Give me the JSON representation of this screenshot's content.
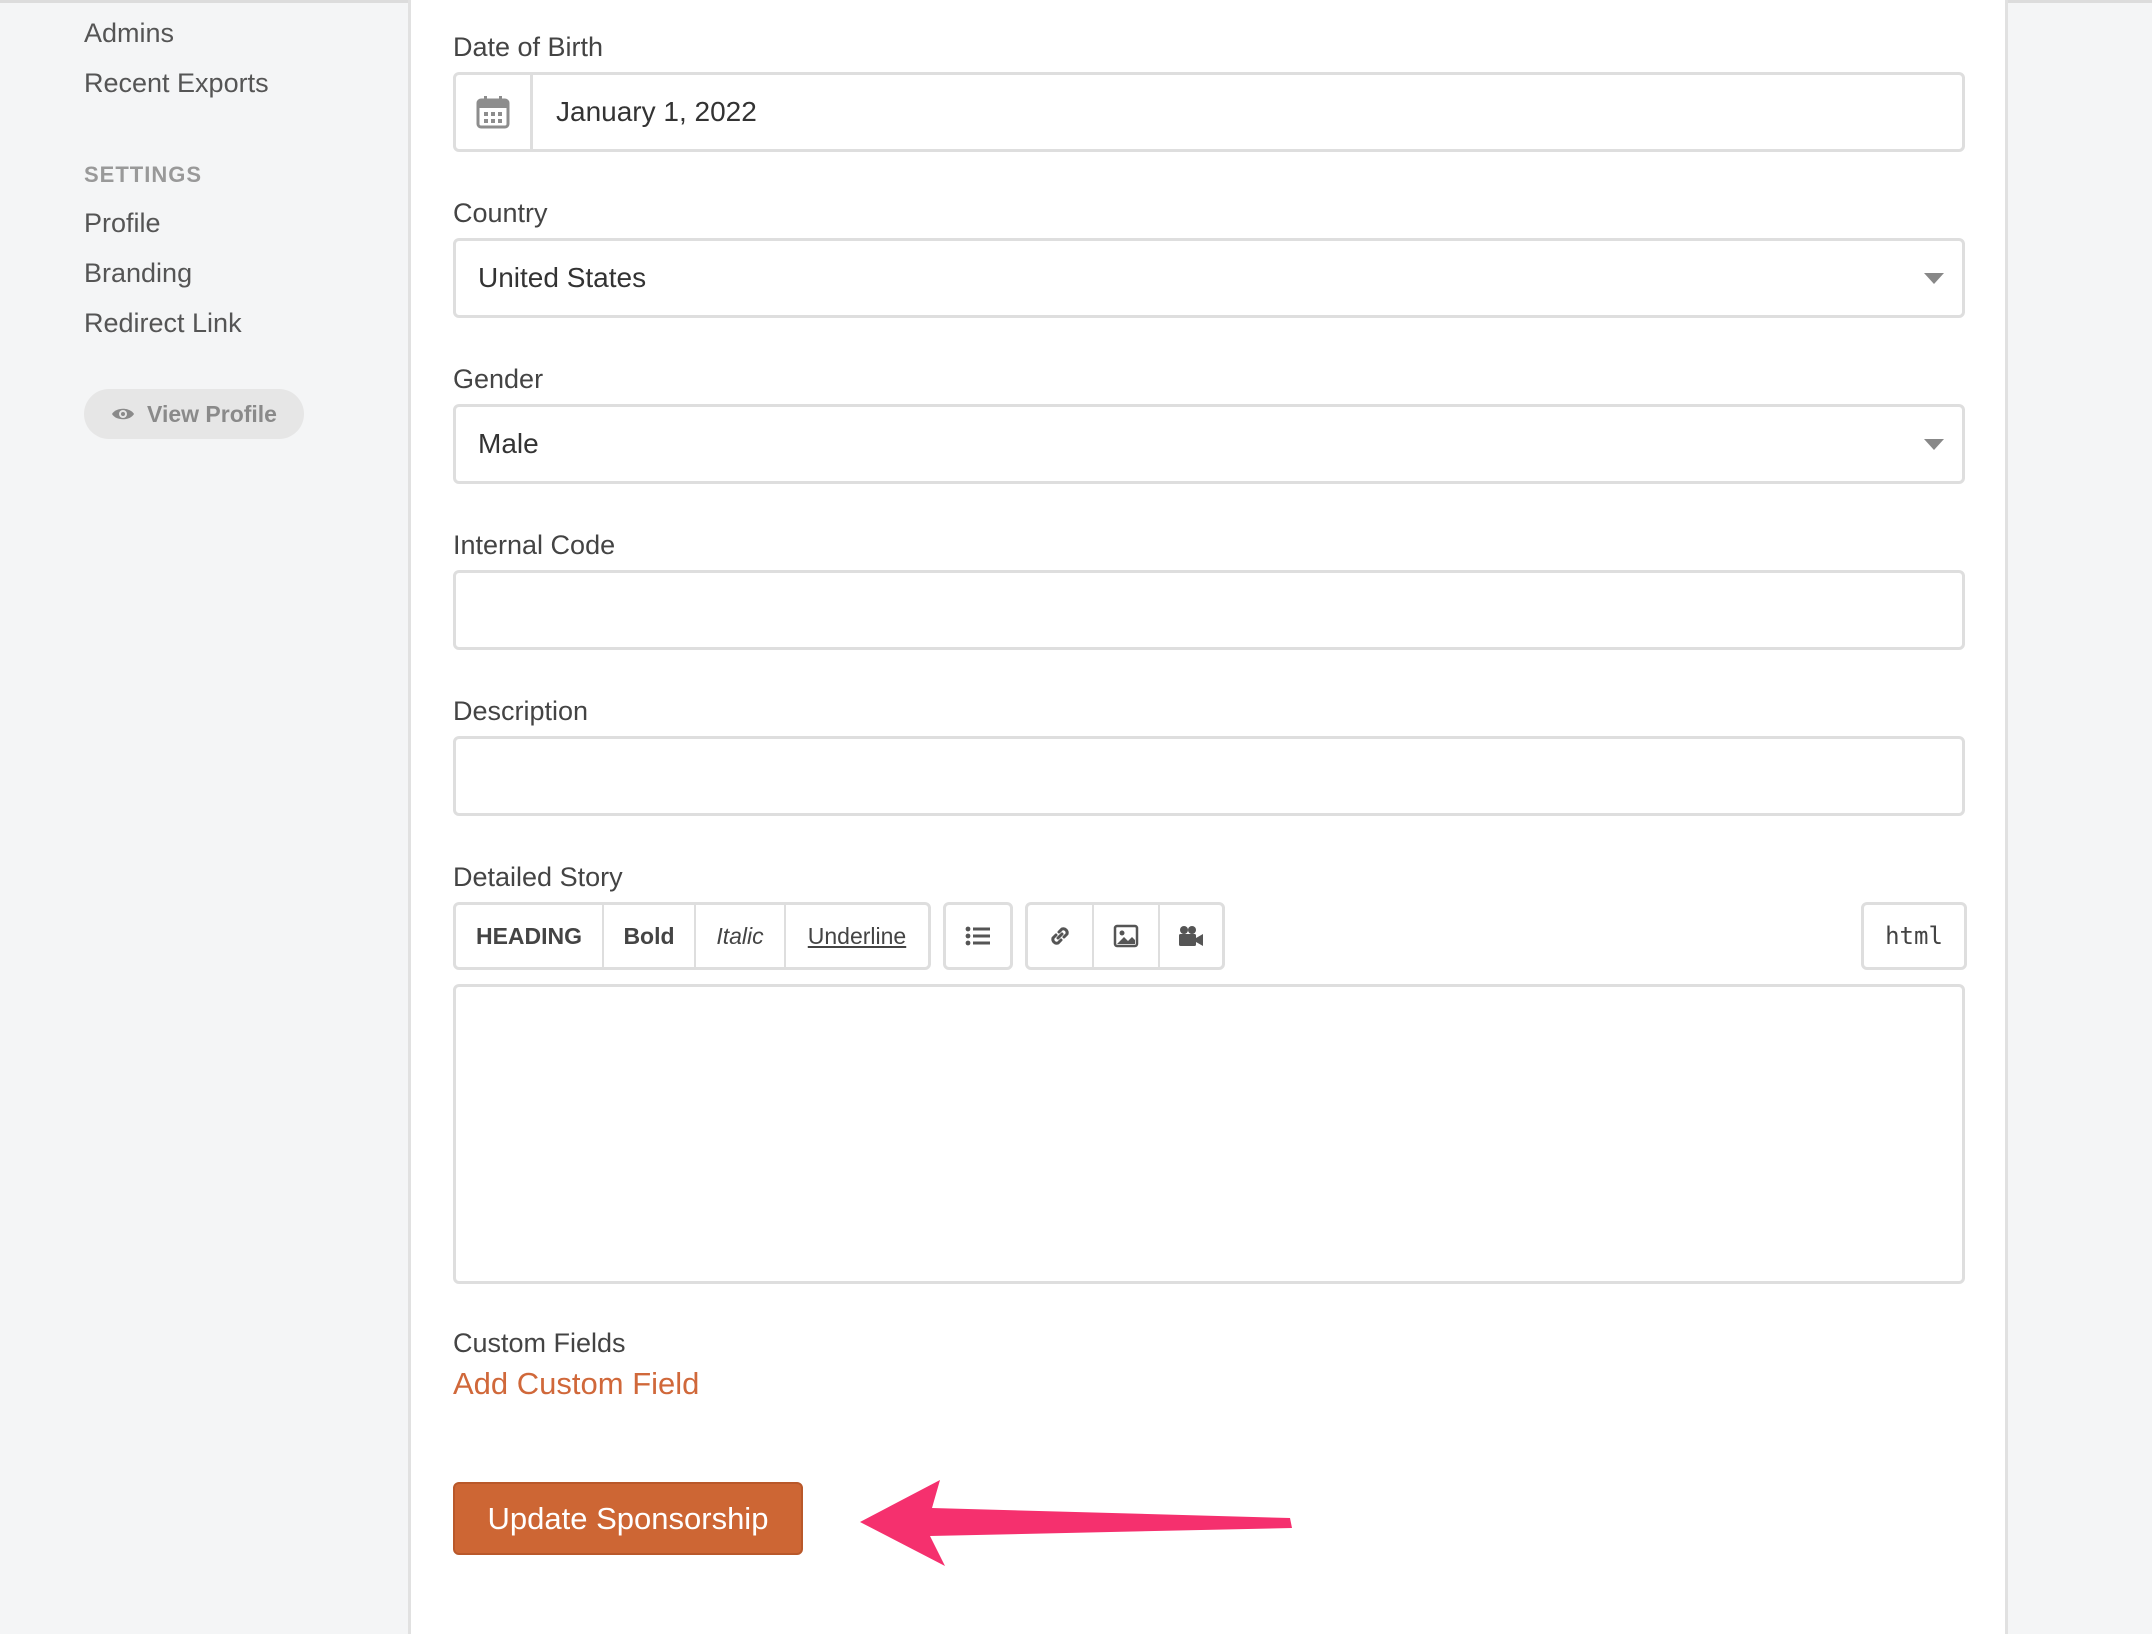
{
  "sidebar": {
    "links_top": [
      "Admins",
      "Recent Exports"
    ],
    "settings_heading": "SETTINGS",
    "settings_links": [
      "Profile",
      "Branding",
      "Redirect Link"
    ],
    "view_profile_label": "View Profile"
  },
  "form": {
    "dob": {
      "label": "Date of Birth",
      "value": "January 1, 2022"
    },
    "country": {
      "label": "Country",
      "value": "United States"
    },
    "gender": {
      "label": "Gender",
      "value": "Male"
    },
    "internal_code": {
      "label": "Internal Code",
      "value": ""
    },
    "description": {
      "label": "Description",
      "value": ""
    },
    "story": {
      "label": "Detailed Story",
      "toolbar": {
        "heading": "HEADING",
        "bold": "Bold",
        "italic": "Italic",
        "underline": "Underline",
        "html": "html"
      }
    },
    "custom_fields": {
      "label": "Custom Fields",
      "add_link": "Add Custom Field"
    },
    "submit_label": "Update Sponsorship"
  },
  "colors": {
    "accent": "#cd6634",
    "link": "#d0683a",
    "annotation_arrow": "#f5306e"
  }
}
